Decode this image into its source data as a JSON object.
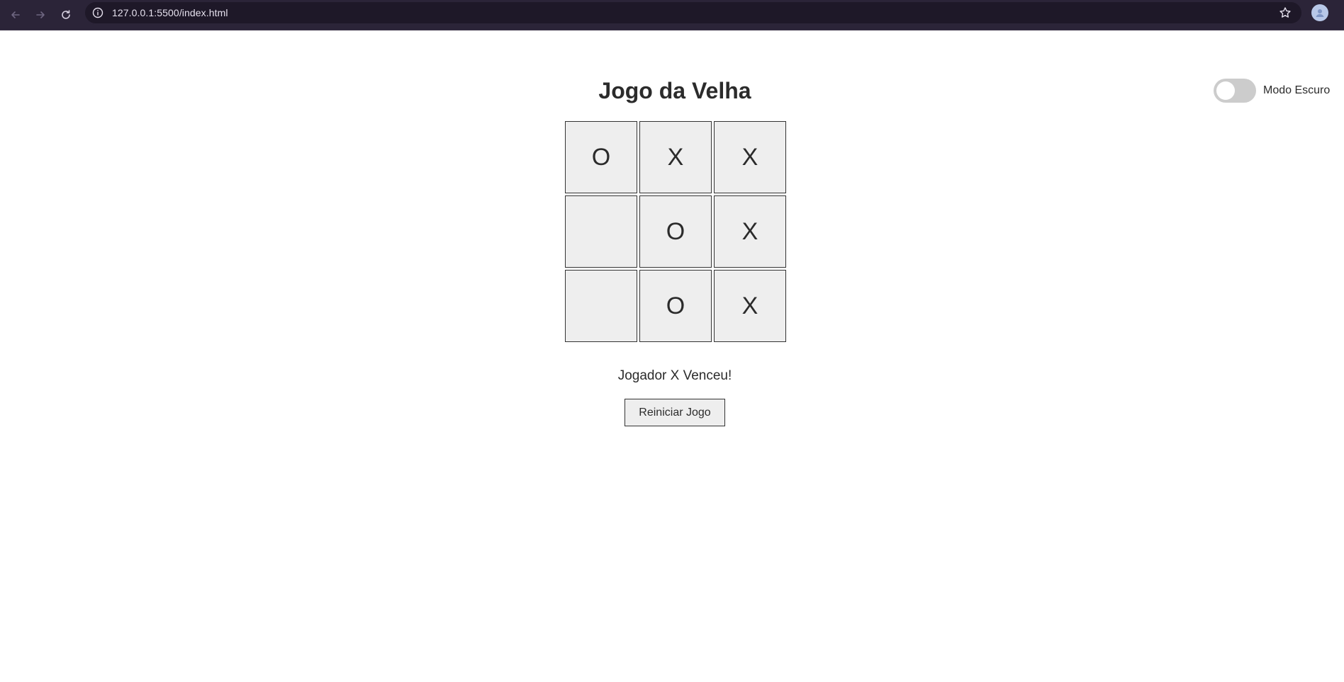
{
  "browser": {
    "url": "127.0.0.1:5500/index.html"
  },
  "page": {
    "title": "Jogo da Velha",
    "status": "Jogador X Venceu!",
    "restart_label": "Reiniciar Jogo",
    "dark_mode_label": "Modo Escuro",
    "dark_mode_on": false
  },
  "board": {
    "cells": [
      "O",
      "X",
      "X",
      "",
      "O",
      "X",
      "",
      "O",
      "X"
    ]
  },
  "icons": {
    "back": "arrow-left-icon",
    "forward": "arrow-right-icon",
    "reload": "reload-icon",
    "info": "info-icon",
    "bookmark": "star-icon",
    "profile": "avatar"
  },
  "colors": {
    "chrome_bg": "#2b2438",
    "omnibox_bg": "#1e1828",
    "cell_bg": "#eeeeee",
    "toggle_off": "#cccccc"
  }
}
